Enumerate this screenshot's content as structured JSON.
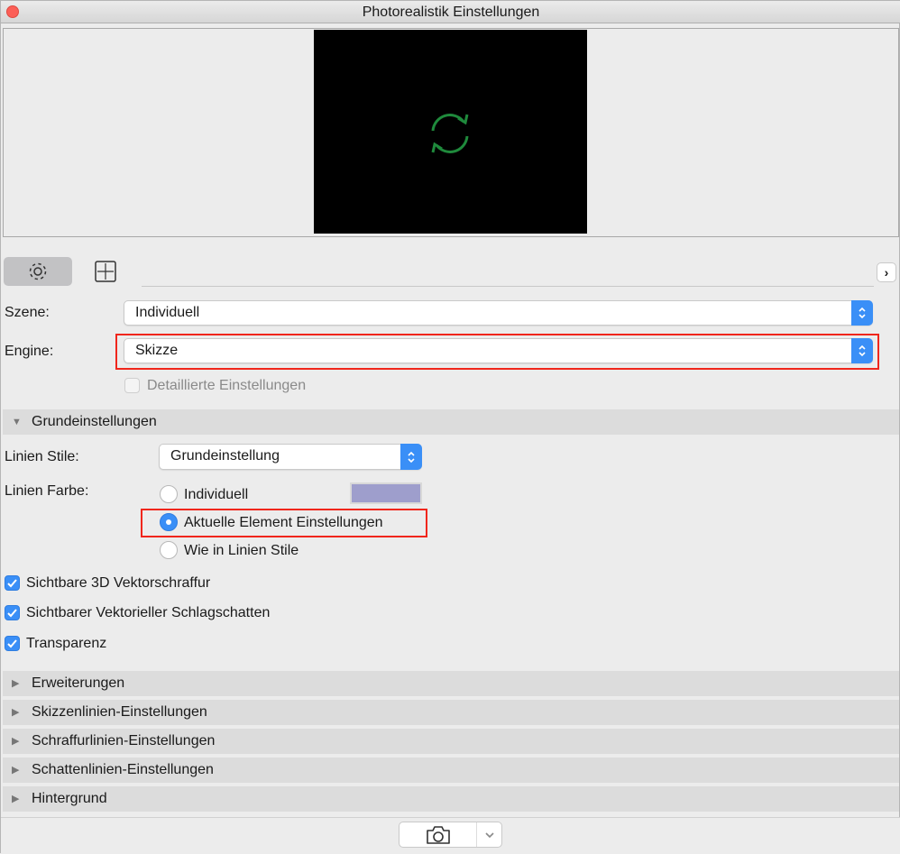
{
  "window": {
    "title": "Photorealistik Einstellungen"
  },
  "tabs": [
    {
      "icon": "gear-icon"
    },
    {
      "icon": "size-icon"
    }
  ],
  "szene": {
    "label": "Szene:",
    "value": "Individuell"
  },
  "engine": {
    "label": "Engine:",
    "value": "Skizze"
  },
  "detail": {
    "label": "Detaillierte Einstellungen",
    "checked": false
  },
  "grund": {
    "title": "Grundeinstellungen",
    "linien_stile": {
      "label": "Linien Stile:",
      "value": "Grundeinstellung"
    },
    "linien_farbe": {
      "label": "Linien Farbe:",
      "swatch": "#9e9ecc",
      "options": [
        "Individuell",
        "Aktuelle Element Einstellungen",
        "Wie in Linien Stile"
      ],
      "selected": 1
    },
    "checks": [
      "Sichtbare 3D Vektorschraffur",
      "Sichtbarer Vektorieller Schlagschatten",
      "Transparenz"
    ]
  },
  "sections": [
    "Erweiterungen",
    "Skizzenlinien-Einstellungen",
    "Schraffurlinien-Einstellungen",
    "Schattenlinien-Einstellungen",
    "Hintergrund"
  ],
  "colors": {
    "accent": "#3a8ff7",
    "highlight": "#f0261c",
    "spinner": "#1f8a3c"
  }
}
